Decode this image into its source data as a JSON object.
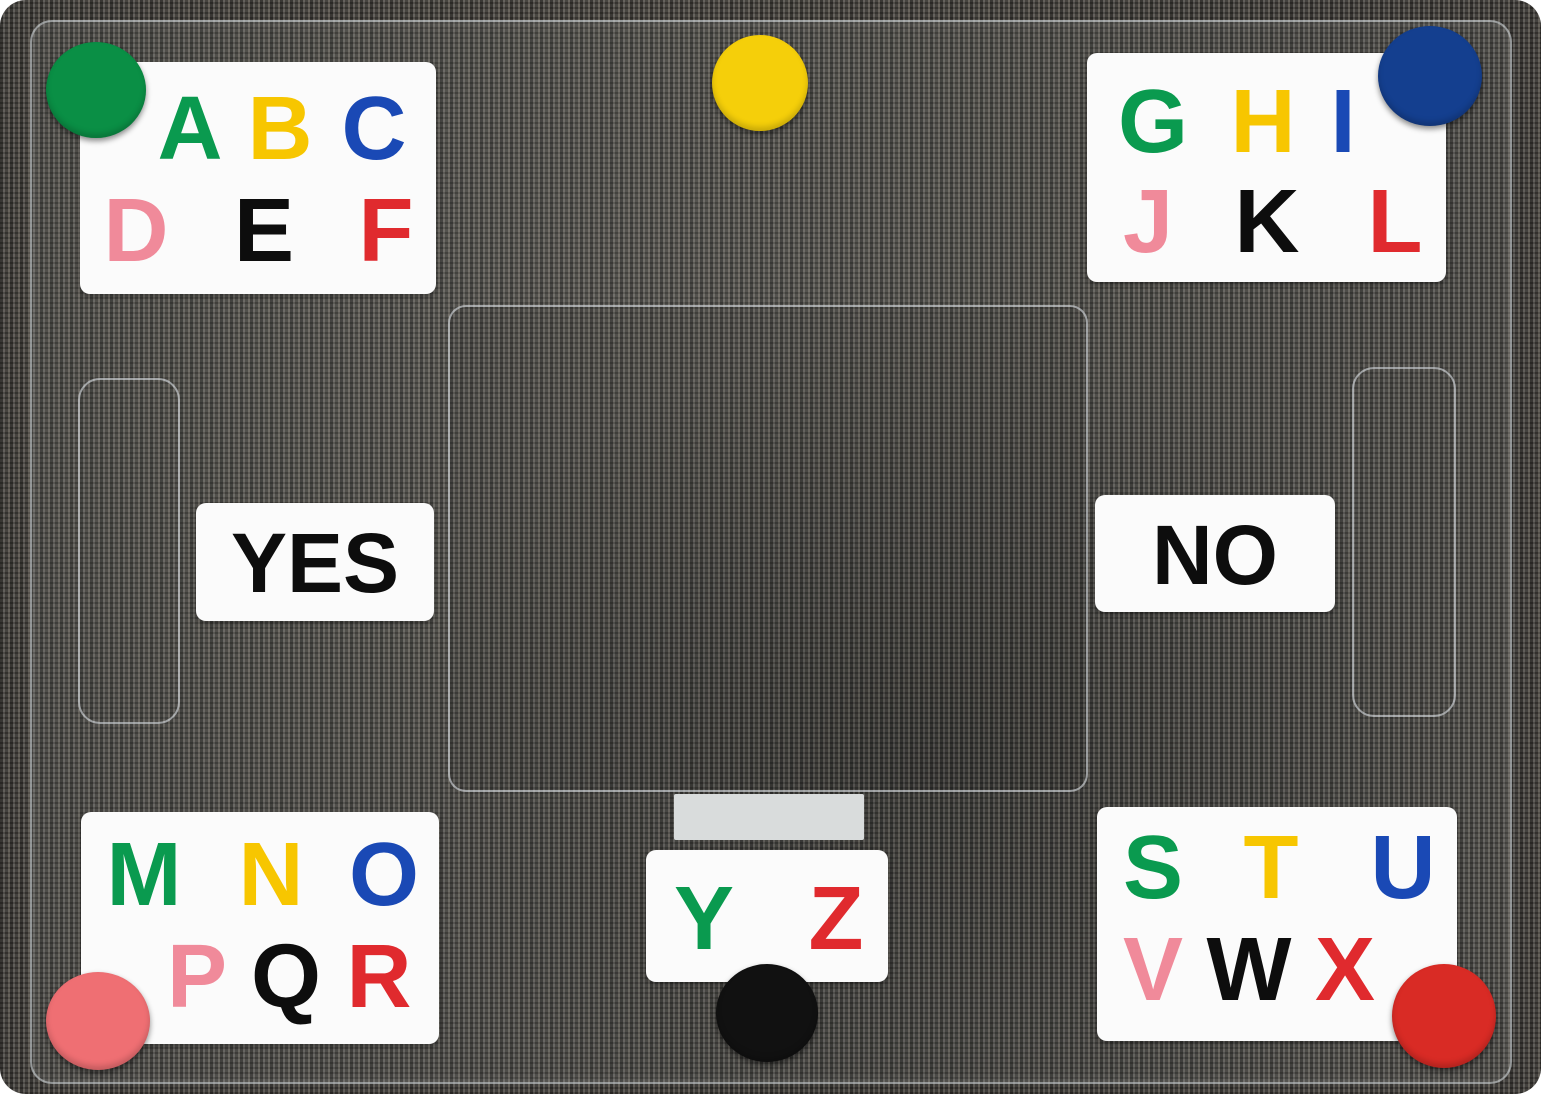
{
  "board": {
    "cards": [
      {
        "letters": [
          "A",
          "B",
          "C",
          "D",
          "E",
          "F"
        ]
      },
      {
        "letters": [
          "G",
          "H",
          "I",
          "J",
          "K",
          "L"
        ]
      },
      {
        "letters": [
          "M",
          "N",
          "O",
          "P",
          "Q",
          "R"
        ]
      },
      {
        "letters": [
          "S",
          "T",
          "U",
          "V",
          "W",
          "X"
        ]
      },
      {
        "letters": [
          "Y",
          "Z"
        ]
      }
    ],
    "yes_label": "YES",
    "no_label": "NO"
  },
  "colors": {
    "green": "#0a9a4f",
    "yellow": "#f7c600",
    "blue": "#1a49b5",
    "pink": "#f08a9a",
    "black": "#0d0d0d",
    "red": "#e02a2e",
    "dot_green": "#0a8f45",
    "dot_yellow": "#f5cf0a",
    "dot_blue": "#143f8f",
    "dot_pink": "#ef6f73",
    "dot_black": "#111111",
    "dot_red": "#d92b25"
  }
}
